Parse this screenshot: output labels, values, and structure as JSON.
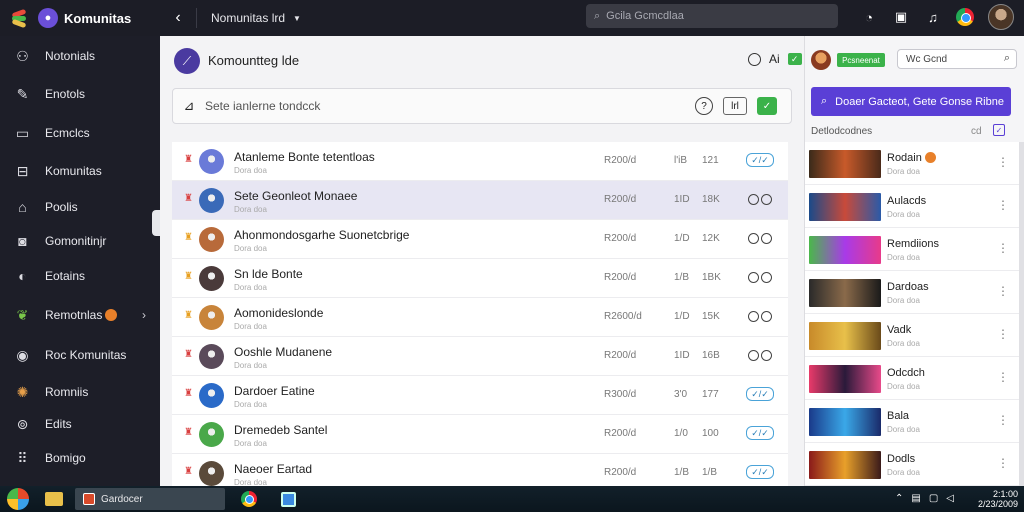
{
  "app": {
    "name": "Komunitas",
    "header_title": "Nomunitas lrd"
  },
  "top": {
    "search_placeholder": "Gcila Gcmcdlaa"
  },
  "sidebar": {
    "items": [
      {
        "label": "Notonials",
        "icon": "users-icon"
      },
      {
        "label": "Enotols",
        "icon": "edit-icon"
      },
      {
        "label": "Ecmclcs",
        "icon": "monitor-icon"
      },
      {
        "label": "Komunitas",
        "icon": "inbox-icon"
      },
      {
        "label": "Poolis",
        "icon": "home-icon"
      },
      {
        "label": "Gomonitinjr",
        "icon": "camera-icon"
      },
      {
        "label": "Eotains",
        "icon": "flame-icon"
      },
      {
        "label": "Remotnlas",
        "icon": "leaf-icon"
      },
      {
        "label": "Roc Komunitas",
        "icon": "globe-icon"
      },
      {
        "label": "Romniis",
        "icon": "palette-icon"
      },
      {
        "label": "Edits",
        "icon": "gamepad-icon"
      },
      {
        "label": "Bomigo",
        "icon": "grid-icon"
      }
    ]
  },
  "main": {
    "title": "Komountteg lde",
    "tools_text": "Ai",
    "compose_placeholder": "Sete ianlerne tondcck",
    "compose_btn2": "lrl",
    "rows": [
      {
        "name": "Atanleme Bonte tetentloas",
        "sub": "Dora doa",
        "c1": "R200/d",
        "c2": "l'iB",
        "c3": "121",
        "action": "pill",
        "rank_color": "#d94040",
        "av": "#6a7ad8",
        "selected": false
      },
      {
        "name": "Sete Geonleot Monaee",
        "sub": "Dora doa",
        "c1": "R200/d",
        "c2": "1ID",
        "c3": "18K",
        "action": "icons",
        "rank_color": "#d94040",
        "av": "#3a6ab8",
        "selected": true
      },
      {
        "name": "Ahonmondosgarhe Suonetcbrige",
        "sub": "Dora doa",
        "c1": "R200/d",
        "c2": "1/D",
        "c3": "12K",
        "action": "icons",
        "rank_color": "#e8a020",
        "av": "#b86a3a",
        "selected": false
      },
      {
        "name": "Sn lde Bonte",
        "sub": "Dora doa",
        "c1": "R200/d",
        "c2": "1/B",
        "c3": "1BK",
        "action": "icons",
        "rank_color": "#e8a020",
        "av": "#4a3a3a",
        "selected": false
      },
      {
        "name": "Aomonideslonde",
        "sub": "Dora doa",
        "c1": "R2600/d",
        "c2": "1/D",
        "c3": "15K",
        "action": "icons",
        "rank_color": "#e8a020",
        "av": "#c8843a",
        "selected": false
      },
      {
        "name": "Ooshle Mudanene",
        "sub": "Dora doa",
        "c1": "R200/d",
        "c2": "1ID",
        "c3": "16B",
        "action": "icons",
        "rank_color": "#d94040",
        "av": "#5a4a5a",
        "selected": false
      },
      {
        "name": "Dardoer Eatine",
        "sub": "Dora doa",
        "c1": "R300/d",
        "c2": "3'0",
        "c3": "177",
        "action": "pill",
        "rank_color": "#d94040",
        "av": "#2a6ac8",
        "selected": false
      },
      {
        "name": "Dremedeb Santel",
        "sub": "Dora doa",
        "c1": "R200/d",
        "c2": "1/0",
        "c3": "100",
        "action": "pill",
        "rank_color": "#d94040",
        "av": "#4aa84a",
        "selected": false
      },
      {
        "name": "Naeoer Eartad",
        "sub": "Dora doa",
        "c1": "R200/d",
        "c2": "1/B",
        "c3": "1/B",
        "action": "pill",
        "rank_color": "#d94040",
        "av": "#5a4a3a",
        "selected": false
      }
    ]
  },
  "right": {
    "search_label": "Wc Gcnd",
    "badge_text": "Pcsneenat",
    "action_button": "Doaer Gacteot, Gete Gonse Ribne",
    "section_label": "Detlodcodnes",
    "section_right": "cd",
    "items": [
      {
        "title": "Rodain",
        "sub": "Dora doa",
        "thumb": "linear-gradient(90deg,#3a2a1a,#c85a2a,#4a2a1a)",
        "badge": true
      },
      {
        "title": "Aulacds",
        "sub": "Dora doa",
        "thumb": "linear-gradient(90deg,#1a4a8a,#c84a3a,#2a5aa8)",
        "badge": false
      },
      {
        "title": "Remdiions",
        "sub": "Dora doa",
        "thumb": "linear-gradient(90deg,#4ab84a,#a83ae8,#e83a8a)",
        "badge": false
      },
      {
        "title": "Dardoas",
        "sub": "Dora doa",
        "thumb": "linear-gradient(90deg,#2a2a2a,#8a6a4a,#1a1a1a)",
        "badge": false
      },
      {
        "title": "Vadk",
        "sub": "Dora doa",
        "thumb": "linear-gradient(90deg,#c88a2a,#e8c04a,#6a4a1a)",
        "badge": false
      },
      {
        "title": "Odcdch",
        "sub": "Dora doa",
        "thumb": "linear-gradient(90deg,#e83a6a,#2a1a3a,#e84a8a)",
        "badge": false
      },
      {
        "title": "Bala",
        "sub": "Dora doa",
        "thumb": "linear-gradient(90deg,#1a3a8a,#3aa8e8,#1a2a6a)",
        "badge": false
      },
      {
        "title": "Dodls",
        "sub": "Dora doa",
        "thumb": "linear-gradient(90deg,#8a1a1a,#e8a02a,#3a1a1a)",
        "badge": false
      }
    ]
  },
  "taskbar": {
    "app_label": "Gardocer",
    "clock_time": "2:1:00",
    "clock_date": "2/23/2009"
  }
}
